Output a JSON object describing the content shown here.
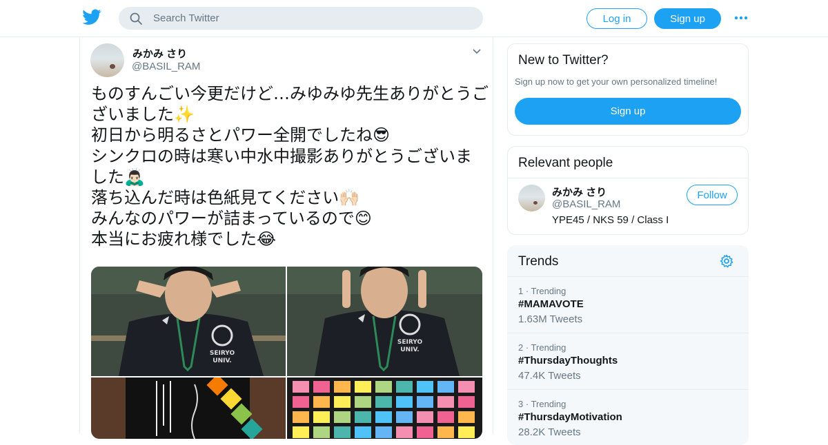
{
  "header": {
    "search_placeholder": "Search Twitter",
    "login_label": "Log in",
    "signup_label": "Sign up",
    "brand_color": "#1da1f2",
    "icons": [
      "twitter-bird-icon",
      "search-icon",
      "more-icon"
    ]
  },
  "tweet": {
    "author_name": "みかみ さり",
    "author_handle": "@BASIL_RAM",
    "lines": [
      "ものすんごい今更だけど…みゆみゆ先生ありがとうご",
      "ざいました✨",
      "初日から明るさとパワー全開でしたね😎",
      "シンクロの時は寒い中水中撮影ありがとうございま",
      "した🙇🏻‍♂️",
      "落ち込んだ時は色紙見てください🙌🏻",
      "みんなのパワーが詰まっているので😊",
      "本当にお疲れ様でした😂"
    ],
    "photo_count": 4
  },
  "sidebar": {
    "new_to_twitter": {
      "title": "New to Twitter?",
      "subtitle": "Sign up now to get your own personalized timeline!",
      "button": "Sign up"
    },
    "relevant_people": {
      "title": "Relevant people",
      "person": {
        "name": "みかみ さり",
        "handle": "@BASIL_RAM",
        "bio": "YPE45 / NKS 59 / Class I",
        "follow_label": "Follow"
      }
    },
    "trends": {
      "title": "Trends",
      "items": [
        {
          "meta": "1 · Trending",
          "tag": "#MAMAVOTE",
          "count": "1.63M Tweets"
        },
        {
          "meta": "2 · Trending",
          "tag": "#ThursdayThoughts",
          "count": "47.4K Tweets"
        },
        {
          "meta": "3 · Trending",
          "tag": "#ThursdayMotivation",
          "count": "28.2K Tweets"
        }
      ]
    }
  }
}
